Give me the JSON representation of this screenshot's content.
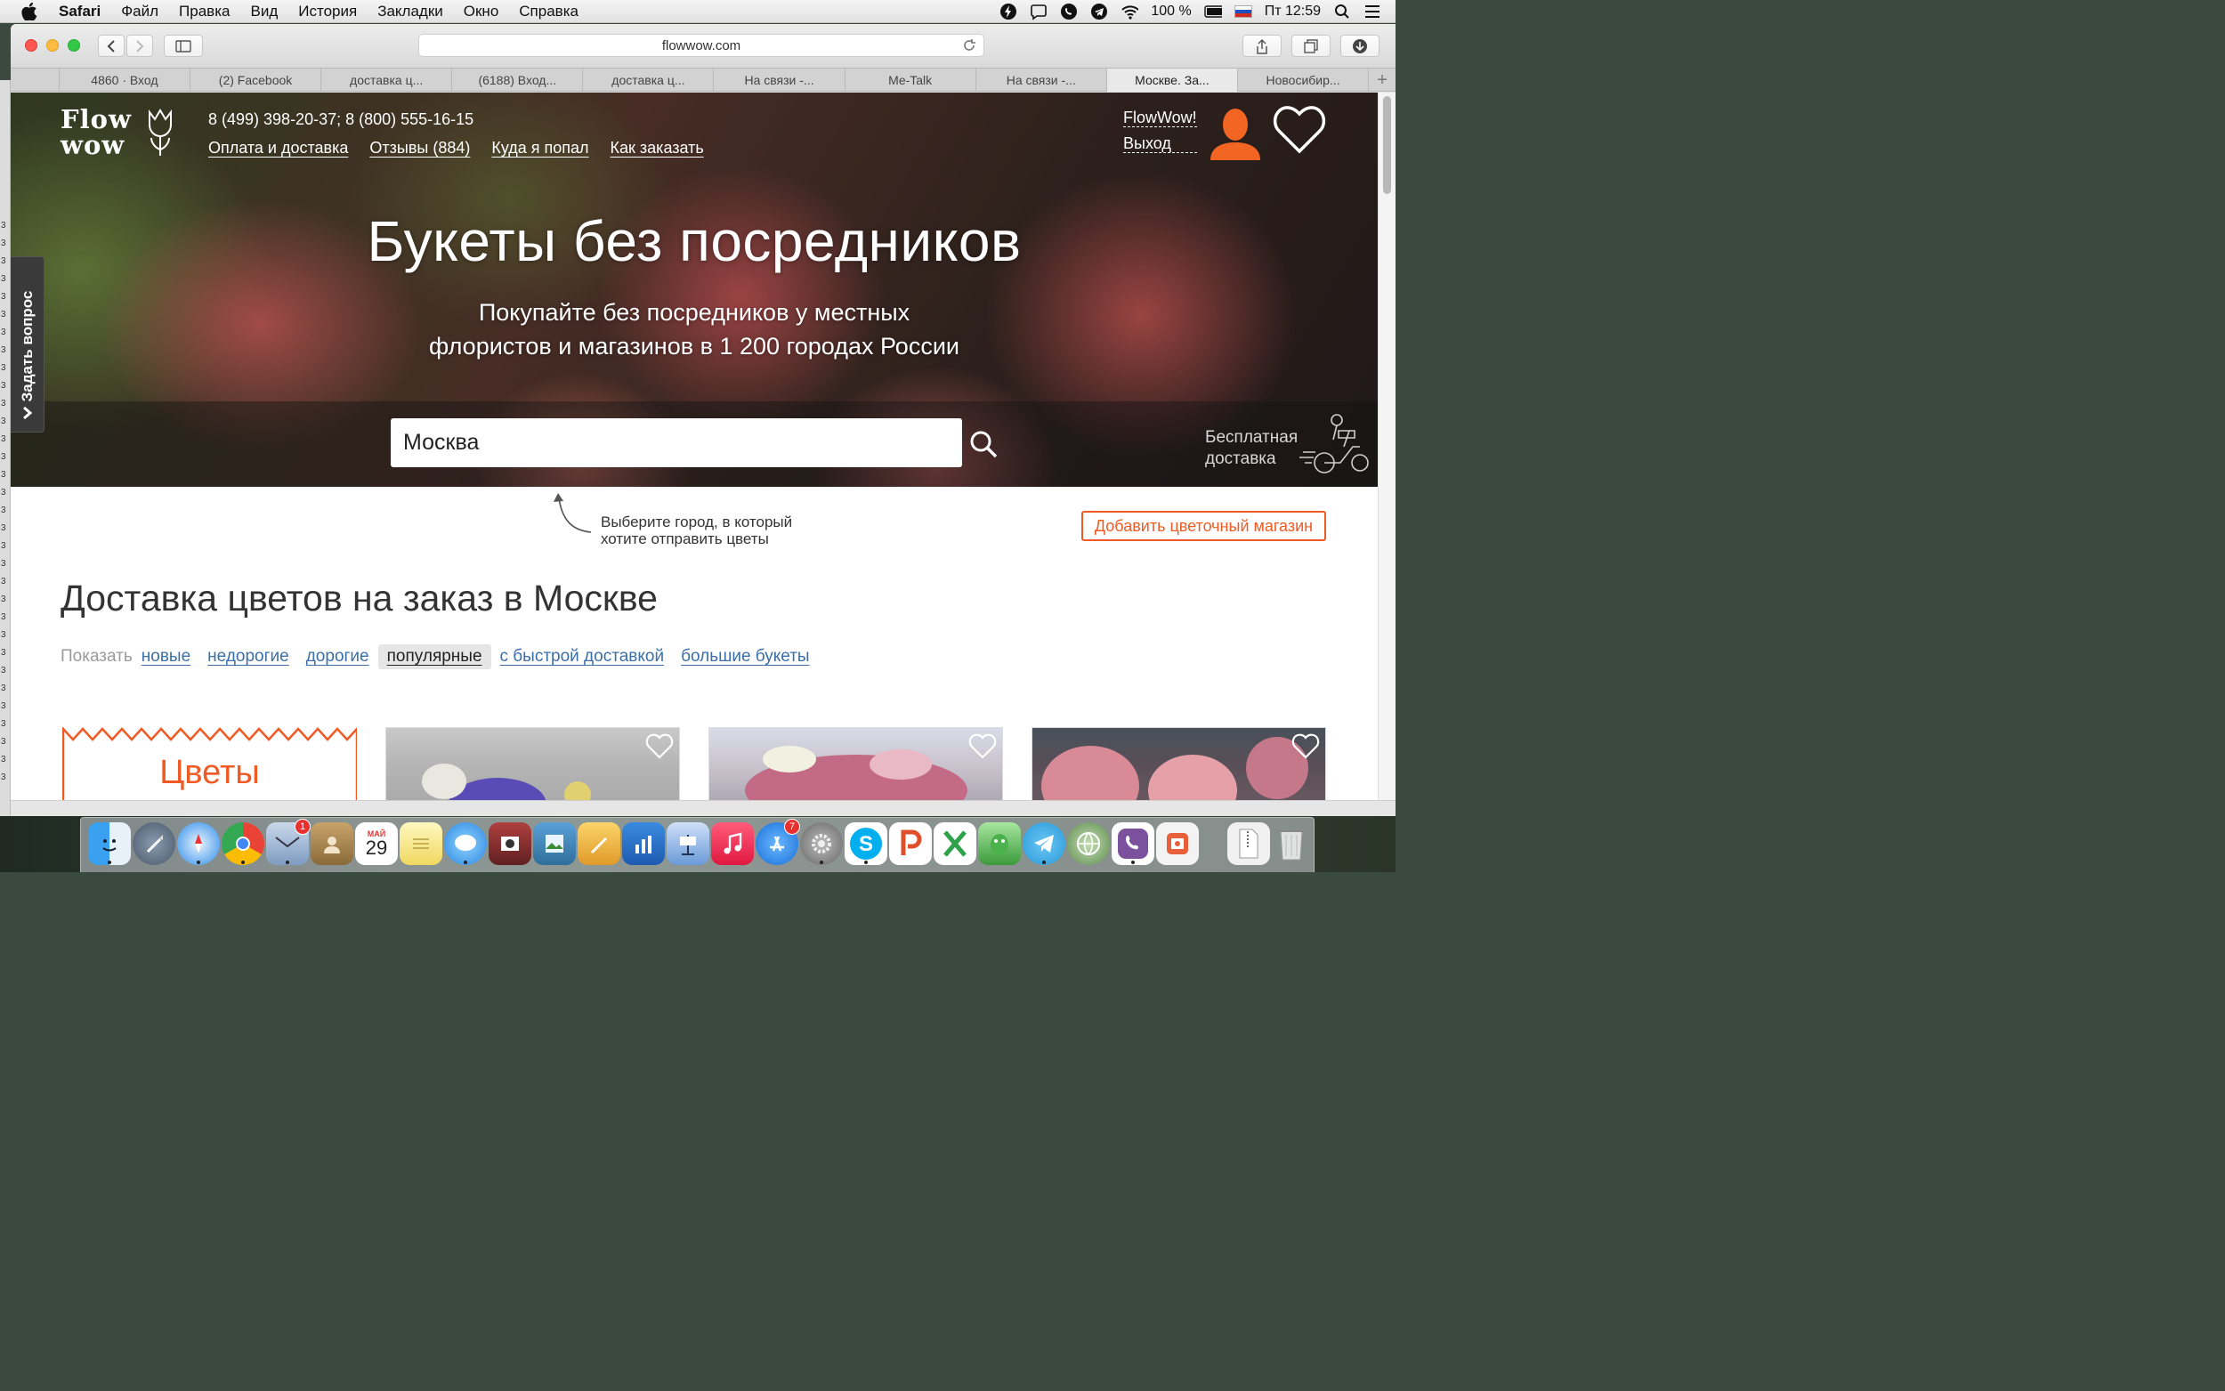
{
  "menubar": {
    "app_name": "Safari",
    "items": [
      "Файл",
      "Правка",
      "Вид",
      "История",
      "Закладки",
      "Окно",
      "Справка"
    ],
    "battery": "100 %",
    "clock": "Пт 12:59"
  },
  "browser": {
    "url": "flowwow.com",
    "tabs": [
      "4860 · Вход",
      "(2) Facebook",
      "доставка ц...",
      "(6188) Вход...",
      "доставка ц...",
      "На связи -...",
      "Me-Talk",
      "На связи -...",
      "Москве. За...",
      "Новосибир..."
    ],
    "active_tab_index": 8,
    "new_tab": "+"
  },
  "header": {
    "logo_line1": "Flow",
    "logo_line2": "wow",
    "phones": "8 (499) 398-20-37; 8 (800) 555-16-15",
    "nav": [
      "Оплата и доставка",
      "Отзывы (884)",
      "Куда я попал",
      "Как заказать"
    ],
    "user_greeting": "FlowWow!",
    "logout": "Выход"
  },
  "hero": {
    "title": "Букеты без посредников",
    "subtitle_line1": "Покупайте без посредников у местных",
    "subtitle_line2": "флористов и магазинов в 1 200 городах России",
    "city_value": "Москва",
    "free_delivery_line1": "Бесплатная",
    "free_delivery_line2": "доставка"
  },
  "ask_tab": {
    "label": "Задать вопрос"
  },
  "hint": {
    "line1": "Выберите город, в который",
    "line2": "хотите отправить цветы"
  },
  "add_shop_button": "Добавить цветочный магазин",
  "section": {
    "title": "Доставка цветов на заказ в Москве",
    "show_label": "Показать",
    "filters": [
      "новые",
      "недорогие",
      "дорогие",
      "популярные",
      "с быстрой доставкой",
      "большие букеты"
    ],
    "active_filter_index": 3
  },
  "cards": {
    "promo_label": "Цветы"
  },
  "desktop_strip_chars": [
    "3",
    "3",
    "3",
    "3",
    "3",
    "3",
    "3",
    "3",
    "3",
    "3",
    "3",
    "3",
    "3",
    "3",
    "3",
    "3",
    "3",
    "3",
    "3",
    "3",
    "3",
    "3",
    "3",
    "3",
    "3",
    "3",
    "3",
    "3",
    "3",
    "3",
    "3",
    "3"
  ],
  "dock": {
    "calendar_month": "МАЙ",
    "calendar_day": "29",
    "mail_badge": "1",
    "appstore_badge": "7"
  },
  "colors": {
    "accent": "#f05a24",
    "link": "#3a6fa8",
    "avatar": "#f26522"
  }
}
